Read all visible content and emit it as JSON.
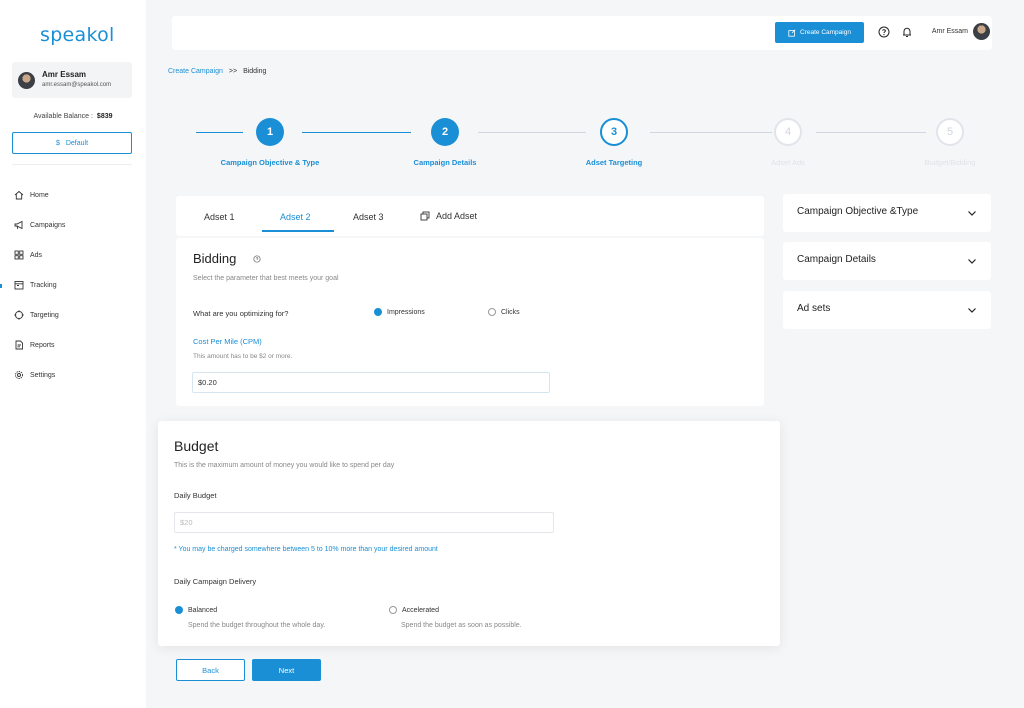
{
  "brand": {
    "logo_text": "speakol",
    "accent": "#1a8fd6"
  },
  "profile": {
    "name": "Amr Essam",
    "email": "amr.essam@speakol.com"
  },
  "balance": {
    "label": "Available Balance :",
    "value": "$839"
  },
  "currency_select": {
    "label": "Default",
    "symbol": "$"
  },
  "nav": [
    {
      "label": "Home",
      "icon": "home-icon"
    },
    {
      "label": "Campaigns",
      "icon": "megaphone-icon"
    },
    {
      "label": "Ads",
      "icon": "grid-icon"
    },
    {
      "label": "Tracking",
      "icon": "calendar-icon"
    },
    {
      "label": "Targeting",
      "icon": "target-icon"
    },
    {
      "label": "Reports",
      "icon": "report-icon"
    },
    {
      "label": "Settings",
      "icon": "gear-icon"
    }
  ],
  "topbar": {
    "create_label": "Create Campaign",
    "user_name": "Amr Essam"
  },
  "breadcrumb": {
    "parent": "Create Campaign",
    "separator": ">>",
    "current": "Bidding"
  },
  "steps": [
    {
      "number": "1",
      "label": "Campaign Objective & Type",
      "state": "done"
    },
    {
      "number": "2",
      "label": "Campaign Details",
      "state": "done"
    },
    {
      "number": "3",
      "label": "Adset Targeting",
      "state": "current"
    },
    {
      "number": "4",
      "label": "Adset Ads",
      "state": "pending"
    },
    {
      "number": "5",
      "label": "Budget/Bidding",
      "state": "pending"
    }
  ],
  "tabs": {
    "adset1": "Adset 1",
    "adset2": "Adset 2",
    "adset3": "Adset 3",
    "add": "Add Adset"
  },
  "bidding": {
    "title": "Bidding",
    "subtitle": "Select the parameter that  best meets your goal",
    "optimize_label": "What are you optimizing for?",
    "option_impressions": "Impressions",
    "option_clicks": "Clicks",
    "cpm_label": "Cost Per Mile (CPM)",
    "cpm_hint": "This amount has to be $2 or more.",
    "cpm_value": "$0.20"
  },
  "budget": {
    "title": "Budget",
    "subtitle": "This is the maximum amount of money you would like to spend per day",
    "daily_label": "Daily Budget",
    "daily_placeholder": "$20",
    "note": "* You may be charged somewhere between 5 to 10% more than your desired amount",
    "delivery_label": "Daily Campaign Delivery",
    "balanced_label": "Balanced",
    "balanced_desc": "Spend the budget throughout the whole day.",
    "accelerated_label": "Accelerated",
    "accelerated_desc": "Spend the budget as soon as possible."
  },
  "accordion": {
    "objective": "Campaign Objective &Type",
    "details": "Campaign Details",
    "adsets": "Ad sets"
  },
  "footer": {
    "back": "Back",
    "next": "Next"
  }
}
